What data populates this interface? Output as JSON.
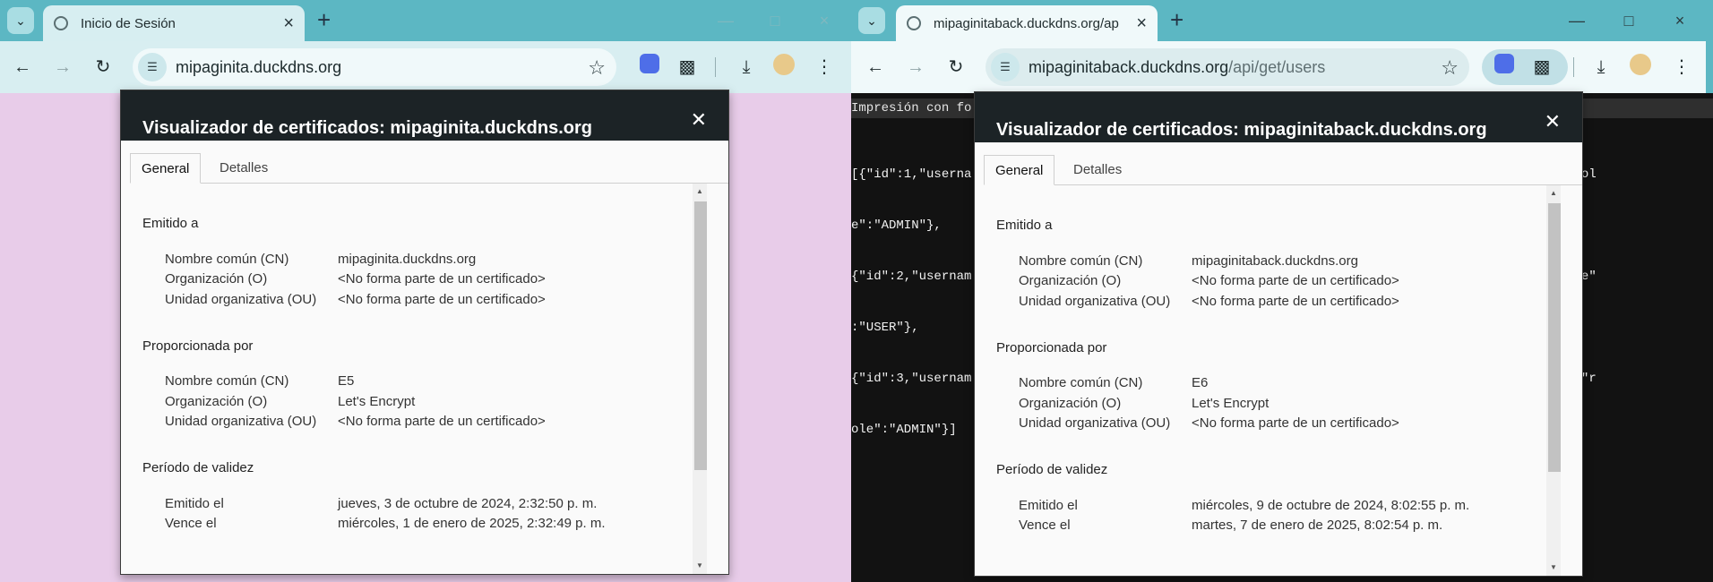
{
  "left": {
    "tab_title": "Inicio de Sesión",
    "url_host": "mipaginita.duckdns.org",
    "url_path": "",
    "cert": {
      "title": "Visualizador de certificados: mipaginita.duckdns.org",
      "tabs": [
        "General",
        "Detalles"
      ],
      "sections": [
        {
          "title": "Emitido a",
          "rows": [
            {
              "k": "Nombre común (CN)",
              "v": "mipaginita.duckdns.org"
            },
            {
              "k": "Organización (O)",
              "v": "<No forma parte de un certificado>"
            },
            {
              "k": "Unidad organizativa (OU)",
              "v": "<No forma parte de un certificado>"
            }
          ]
        },
        {
          "title": "Proporcionada por",
          "rows": [
            {
              "k": "Nombre común (CN)",
              "v": "E5"
            },
            {
              "k": "Organización (O)",
              "v": "Let's Encrypt"
            },
            {
              "k": "Unidad organizativa (OU)",
              "v": "<No forma parte de un certificado>"
            }
          ]
        },
        {
          "title": "Período de validez",
          "rows": [
            {
              "k": "Emitido el",
              "v": "jueves, 3 de octubre de 2024, 2:32:50 p. m."
            },
            {
              "k": "Vence el",
              "v": "miércoles, 1 de enero de 2025, 2:32:49 p. m."
            }
          ]
        }
      ]
    }
  },
  "right": {
    "tab_title": "mipaginitaback.duckdns.org/ap",
    "url_host": "mipaginitaback.duckdns.org",
    "url_path": "/api/get/users",
    "print_label": "Impresión con fo",
    "json_lines": [
      "[{\"id\":1,\"userna                                                                    )/P3LLuWC\",\"rol",
      "e\":\"ADMIN\"},",
      "{\"id\":2,\"usernam                                                                    D7xFF/O\",\"role\"",
      ":\"USER\"},",
      "{\"id\":3,\"usernam                                                                    52rHNz9TV/W\",\"r",
      "ole\":\"ADMIN\"}]"
    ],
    "cert": {
      "title": "Visualizador de certificados: mipaginitaback.duckdns.org",
      "tabs": [
        "General",
        "Detalles"
      ],
      "sections": [
        {
          "title": "Emitido a",
          "rows": [
            {
              "k": "Nombre común (CN)",
              "v": "mipaginitaback.duckdns.org"
            },
            {
              "k": "Organización (O)",
              "v": "<No forma parte de un certificado>"
            },
            {
              "k": "Unidad organizativa (OU)",
              "v": "<No forma parte de un certificado>"
            }
          ]
        },
        {
          "title": "Proporcionada por",
          "rows": [
            {
              "k": "Nombre común (CN)",
              "v": "E6"
            },
            {
              "k": "Organización (O)",
              "v": "Let's Encrypt"
            },
            {
              "k": "Unidad organizativa (OU)",
              "v": "<No forma parte de un certificado>"
            }
          ]
        },
        {
          "title": "Período de validez",
          "rows": [
            {
              "k": "Emitido el",
              "v": "miércoles, 9 de octubre de 2024, 8:02:55 p. m."
            },
            {
              "k": "Vence el",
              "v": "martes, 7 de enero de 2025, 8:02:54 p. m."
            }
          ]
        }
      ]
    }
  },
  "icons": {
    "tab_menu": "chevron-down-icon",
    "new_tab": "plus-icon",
    "back": "arrow-left-icon",
    "forward": "arrow-right-icon",
    "reload": "reload-icon",
    "site_info": "tune-icon",
    "bookmark": "star-icon",
    "extensions": "puzzle-icon",
    "download": "download-icon",
    "menu": "kebab-icon"
  }
}
